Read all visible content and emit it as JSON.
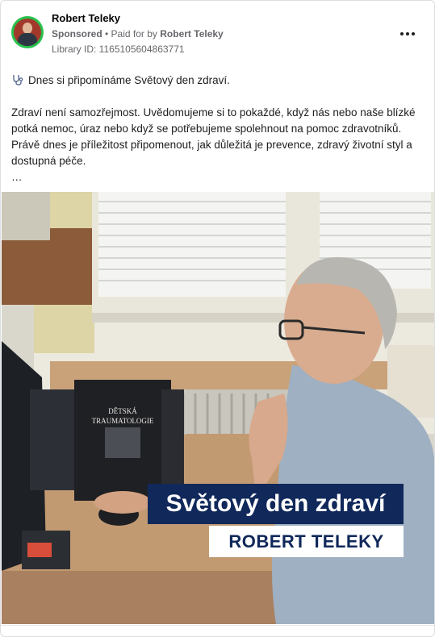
{
  "post": {
    "author": "Robert Teleky",
    "sponsored_label": "Sponsored",
    "paid_for_prefix": "• Paid for by",
    "paid_for_name": "Robert Teleky",
    "library_id": "Library ID: 1165105604863771",
    "more_icon": "ellipsis-icon",
    "emoji_icon": "stethoscope-icon",
    "line1": "Dnes si připomínáme Světový den zdraví.",
    "paragraph": "Zdraví není samozřejmost. Uvědomujeme si to pokaždé, když nás nebo naše blízké potká nemoc, úraz nebo když se potřebujeme spolehnout na pomoc zdravotníků. Právě dnes je příležitost připomenout, jak důležitá je prevence, zdravý životní styl a dostupná péče.",
    "see_more": "…"
  },
  "image": {
    "banner_title": "Světový den zdraví",
    "banner_name": "ROBERT TELEKY",
    "book_title_line1": "DĚTSKÁ",
    "book_title_line2": "TRAUMATOLOGIE"
  },
  "colors": {
    "avatar_ring": "#27c24c",
    "banner_blue": "#10285a"
  }
}
